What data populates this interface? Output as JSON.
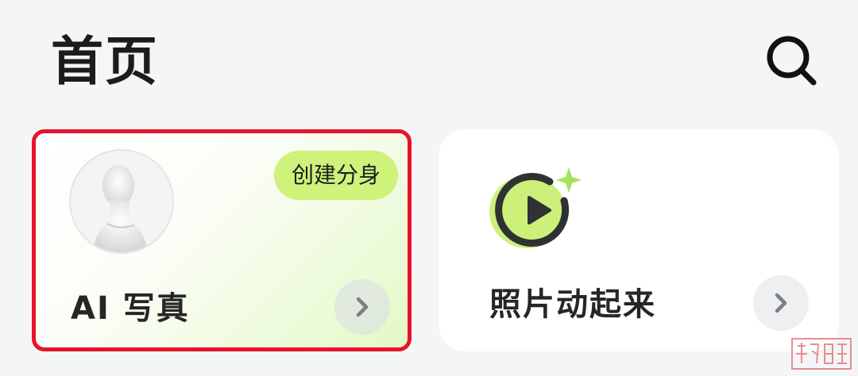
{
  "header": {
    "title": "首页",
    "search_icon": "search-icon"
  },
  "cards": [
    {
      "label": "AI 写真",
      "tag": "创建分身",
      "icon": "avatar-bust-icon",
      "chevron_icon": "chevron-right-icon",
      "highlighted": true,
      "highlight_color": "#e8132b"
    },
    {
      "label": "照片动起来",
      "icon": "play-circle-sparkle-icon",
      "chevron_icon": "chevron-right-icon"
    }
  ],
  "colors": {
    "accent_green": "#cef27a",
    "background": "#f4f5f7",
    "watermark": "#e37b7b"
  }
}
